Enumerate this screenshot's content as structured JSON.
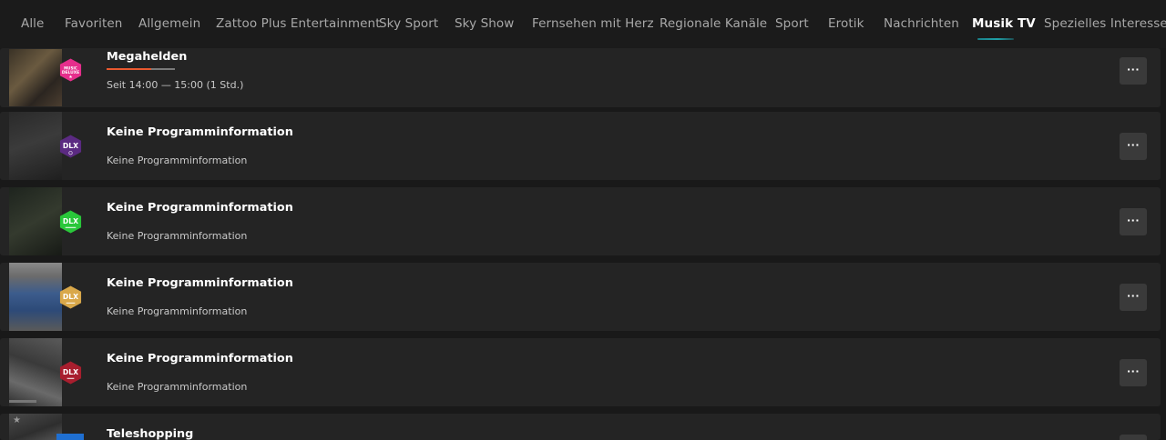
{
  "nav": {
    "tabs": [
      {
        "label": "Alle"
      },
      {
        "label": "Favoriten"
      },
      {
        "label": "Allgemein"
      },
      {
        "label": "Zattoo Plus Entertainment"
      },
      {
        "label": "Sky Sport"
      },
      {
        "label": "Sky Show"
      },
      {
        "label": "Fernsehen mit Herz"
      },
      {
        "label": "Regionale Kanäle"
      },
      {
        "label": "Sport"
      },
      {
        "label": "Erotik"
      },
      {
        "label": "Nachrichten"
      },
      {
        "label": "Musik TV"
      },
      {
        "label": "Spezielles Interesse"
      }
    ],
    "active_tab": "Musik TV"
  },
  "channels": [
    {
      "logo": "DELUXE",
      "logo_color": "#e62e8c",
      "title": "Megahelden",
      "subtitle": "Seit 14:00 — 15:00 (1 Std.)",
      "progress": 0.65
    },
    {
      "logo": "DLX",
      "logo_color": "#5b2a82",
      "title": "Keine Programminformation",
      "subtitle": "Keine Programminformation"
    },
    {
      "logo": "DLX",
      "logo_color": "#29c73a",
      "title": "Keine Programminformation",
      "subtitle": "Keine Programminformation"
    },
    {
      "logo": "DLX",
      "logo_color": "#d9a84a",
      "title": "Keine Programminformation",
      "subtitle": "Keine Programminformation"
    },
    {
      "logo": "DLX",
      "logo_color": "#a81e2e",
      "title": "Keine Programminformation",
      "subtitle": "Keine Programminformation"
    },
    {
      "logo": "",
      "logo_color": "#1f6fd1",
      "title": "Teleshopping",
      "subtitle": ""
    }
  ],
  "more_button_label": "···",
  "colors": {
    "accent": "#1fa1a8",
    "progress": "#e9592f",
    "background": "#191919",
    "row": "#242424"
  }
}
